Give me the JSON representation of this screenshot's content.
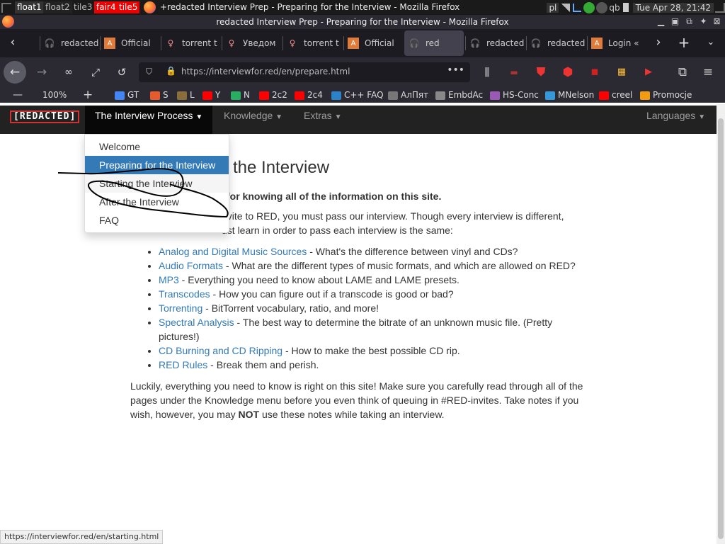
{
  "wm": {
    "workspaces": [
      {
        "label": "float1",
        "state": "current"
      },
      {
        "label": "float2",
        "state": "normal"
      },
      {
        "label": "tile3",
        "state": "normal"
      },
      {
        "label": "fair4",
        "state": "urgent"
      },
      {
        "label": "tile5",
        "state": "urgent"
      }
    ],
    "window_title": "+redacted Interview Prep - Preparing for the Interview - Mozilla Firefox",
    "kb_layout": "pl",
    "tray_qb": "qb",
    "clock": "Tue Apr 28, 21:42"
  },
  "window": {
    "title": "redacted Interview Prep - Preparing for the Interview - Mozilla Firefox"
  },
  "tabs": [
    {
      "label": "redacted",
      "icon": "headphones-icon"
    },
    {
      "label": "Official",
      "icon": "ab-logo-icon"
    },
    {
      "label": "torrent t",
      "icon": "figure-icon"
    },
    {
      "label": "Уведом",
      "icon": "figure-icon"
    },
    {
      "label": "torrent t",
      "icon": "figure-icon"
    },
    {
      "label": "Official",
      "icon": "ab-logo-icon"
    },
    {
      "label": "red",
      "icon": "headphones-icon",
      "active": true
    },
    {
      "label": "redacted",
      "icon": "headphones-icon"
    },
    {
      "label": "redacted",
      "icon": "headphones-icon"
    },
    {
      "label": "Login «",
      "icon": "ab-logo-icon"
    }
  ],
  "nav": {
    "url": "https://interviewfor.red/en/prepare.html"
  },
  "zoom": {
    "minus": "—",
    "level": "100%",
    "plus": "+"
  },
  "bookmarks": [
    {
      "label": "GT",
      "color": "#4285f4"
    },
    {
      "label": "S",
      "color": "#e55b2b"
    },
    {
      "label": "L",
      "color": "#8a6d3b"
    },
    {
      "label": "Y",
      "color": "#ff0000"
    },
    {
      "label": "N",
      "color": "#27ae60"
    },
    {
      "label": "2c2",
      "color": "#ff0000"
    },
    {
      "label": "2c4",
      "color": "#ff0000"
    },
    {
      "label": "C++ FAQ",
      "color": "#2c82c9"
    },
    {
      "label": "АлПят",
      "color": "#777777"
    },
    {
      "label": "EmbdAc",
      "color": "#888888"
    },
    {
      "label": "HS-Conc",
      "color": "#9b59b6"
    },
    {
      "label": "MNelson",
      "color": "#3498db"
    },
    {
      "label": "creel",
      "color": "#ff0000"
    },
    {
      "label": "Promocje",
      "color": "#f39c12"
    }
  ],
  "site": {
    "logo": "[REDACTED]",
    "nav": {
      "interview_process": "The Interview Process",
      "knowledge": "Knowledge",
      "extras": "Extras",
      "languages": "Languages"
    },
    "dropdown": [
      {
        "label": "Welcome"
      },
      {
        "label": "Preparing for the Interview",
        "selected": true
      },
      {
        "label": "Starting the Interview",
        "hover": true
      },
      {
        "label": "After the Interview"
      },
      {
        "label": "FAQ"
      }
    ],
    "title_fragment": "the Interview",
    "bold_fragment": "for knowing all of the information on this site.",
    "para1_fragment": "nvite to RED, you must pass our interview. Though every interview is different,",
    "para1_line2": "ust learn in order to pass each interview is the same:",
    "topics": [
      {
        "link": "Analog and Digital Music Sources",
        "desc": " - What's the difference between vinyl and CDs?"
      },
      {
        "link": "Audio Formats",
        "desc": " - What are the different types of music formats, and which are allowed on RED?"
      },
      {
        "link": "MP3",
        "desc": " - Everything you need to know about LAME and LAME presets."
      },
      {
        "link": "Transcodes",
        "desc": " - How you can figure out if a transcode is good or bad?"
      },
      {
        "link": "Torrenting",
        "desc": " - BitTorrent vocabulary, ratio, and more!"
      },
      {
        "link": "Spectral Analysis",
        "desc": " - The best way to determine the bitrate of an unknown music file. (Pretty pictures!)"
      },
      {
        "link": "CD Burning and CD Ripping",
        "desc": " - How to make the best possible CD rip."
      },
      {
        "link": "RED Rules",
        "desc": " - Break them and perish."
      }
    ],
    "para2_a": "Luckily, everything you need to know is right on this site! Make sure you carefully read through all of the pages under the Knowledge menu before you even think of queuing in #RED-invites. Take notes if you wish, however, you may ",
    "para2_not": "NOT",
    "para2_b": " use these notes while taking an interview."
  },
  "status_url": "https://interviewfor.red/en/starting.html"
}
